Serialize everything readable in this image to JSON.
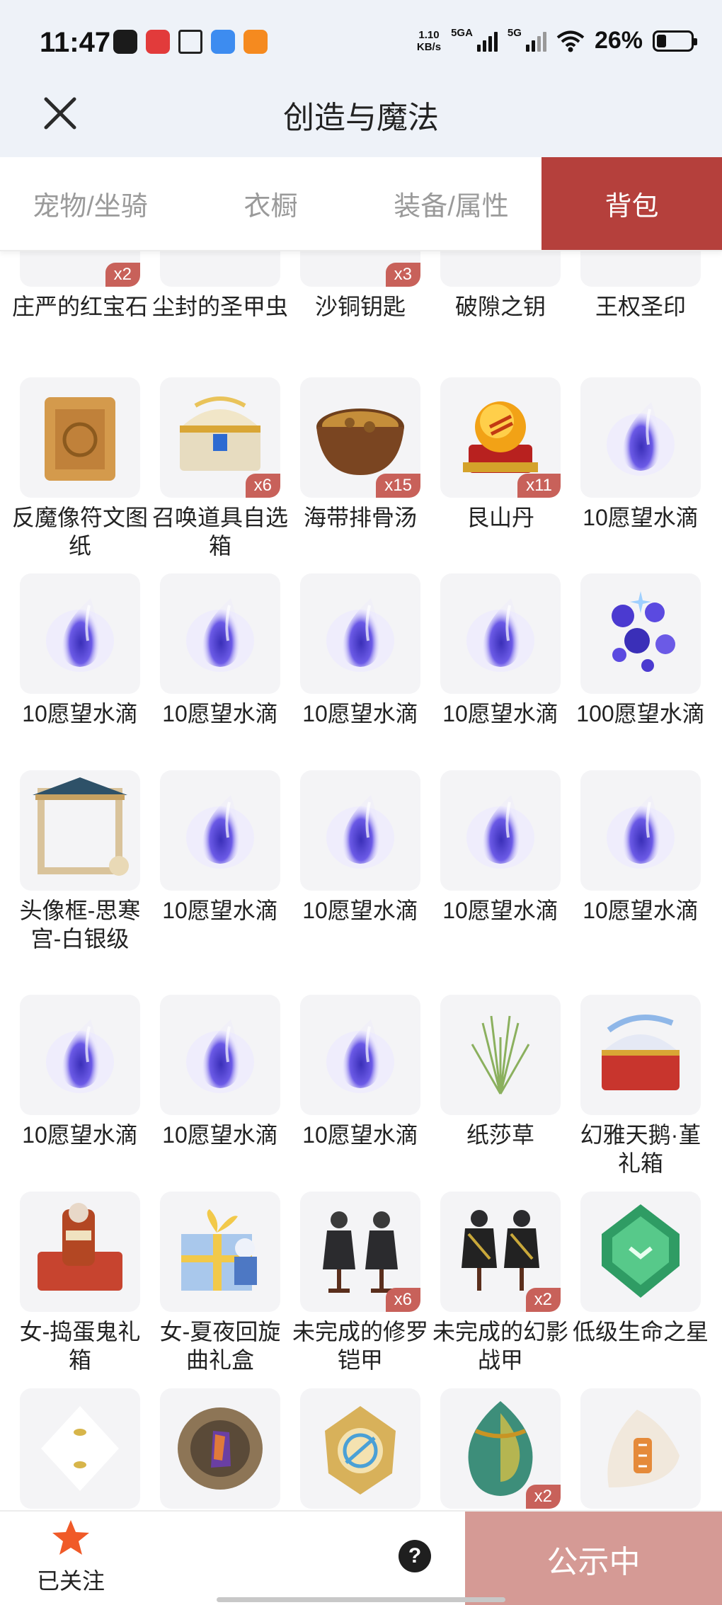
{
  "status_bar": {
    "time": "11:47",
    "net_speed_value": "1.10",
    "net_speed_unit": "KB/s",
    "signal_1": "5GA",
    "signal_2": "5G",
    "battery": "26%"
  },
  "header": {
    "title": "创造与魔法",
    "close_icon": "close-icon"
  },
  "tabs": [
    {
      "label": "宠物/坐骑",
      "active": false
    },
    {
      "label": "衣橱",
      "active": false
    },
    {
      "label": "装备/属性",
      "active": false
    },
    {
      "label": "背包",
      "active": true
    }
  ],
  "items": [
    {
      "name": "庄严的红宝石",
      "qty": "x2",
      "icon": "red-gem"
    },
    {
      "name": "尘封的圣甲虫",
      "qty": "",
      "icon": "scarab"
    },
    {
      "name": "沙铜钥匙",
      "qty": "x3",
      "icon": "key"
    },
    {
      "name": "破隙之钥",
      "qty": "",
      "icon": "key-dark"
    },
    {
      "name": "王权圣印",
      "qty": "",
      "icon": "seal"
    },
    {
      "name": "反魔像符文图纸",
      "qty": "",
      "icon": "scroll"
    },
    {
      "name": "召唤道具自选箱",
      "qty": "x6",
      "icon": "chest"
    },
    {
      "name": "海带排骨汤",
      "qty": "x15",
      "icon": "soup"
    },
    {
      "name": "艮山丹",
      "qty": "x11",
      "icon": "pill-orb"
    },
    {
      "name": "10愿望水滴",
      "qty": "",
      "icon": "wish-drop"
    },
    {
      "name": "10愿望水滴",
      "qty": "",
      "icon": "wish-drop"
    },
    {
      "name": "10愿望水滴",
      "qty": "",
      "icon": "wish-drop"
    },
    {
      "name": "10愿望水滴",
      "qty": "",
      "icon": "wish-drop"
    },
    {
      "name": "10愿望水滴",
      "qty": "",
      "icon": "wish-drop"
    },
    {
      "name": "100愿望水滴",
      "qty": "",
      "icon": "wish-drops"
    },
    {
      "name": "头像框-思寒宫-白银级",
      "qty": "",
      "icon": "avatar-frame"
    },
    {
      "name": "10愿望水滴",
      "qty": "",
      "icon": "wish-drop"
    },
    {
      "name": "10愿望水滴",
      "qty": "",
      "icon": "wish-drop"
    },
    {
      "name": "10愿望水滴",
      "qty": "",
      "icon": "wish-drop"
    },
    {
      "name": "10愿望水滴",
      "qty": "",
      "icon": "wish-drop"
    },
    {
      "name": "10愿望水滴",
      "qty": "",
      "icon": "wish-drop"
    },
    {
      "name": "10愿望水滴",
      "qty": "",
      "icon": "wish-drop"
    },
    {
      "name": "10愿望水滴",
      "qty": "",
      "icon": "wish-drop"
    },
    {
      "name": "纸莎草",
      "qty": "",
      "icon": "papyrus"
    },
    {
      "name": "幻雅天鹅·堇礼箱",
      "qty": "",
      "icon": "gift-chest"
    },
    {
      "name": "女-捣蛋鬼礼箱",
      "qty": "",
      "icon": "costume-box"
    },
    {
      "name": "女-夏夜回旋曲礼盒",
      "qty": "",
      "icon": "gift-box"
    },
    {
      "name": "未完成的修罗铠甲",
      "qty": "x6",
      "icon": "armor"
    },
    {
      "name": "未完成的幻影战甲",
      "qty": "x2",
      "icon": "armor-gold"
    },
    {
      "name": "低级生命之星",
      "qty": "",
      "icon": "green-gem"
    },
    {
      "name": "",
      "qty": "",
      "icon": "white-crystal"
    },
    {
      "name": "",
      "qty": "",
      "icon": "bronze-shield"
    },
    {
      "name": "",
      "qty": "",
      "icon": "gold-compass"
    },
    {
      "name": "",
      "qty": "x2",
      "icon": "egg"
    },
    {
      "name": "",
      "qty": "",
      "icon": "shell"
    }
  ],
  "bottom_bar": {
    "follow_label": "已关注",
    "help_label": "?",
    "public_label": "公示中"
  }
}
